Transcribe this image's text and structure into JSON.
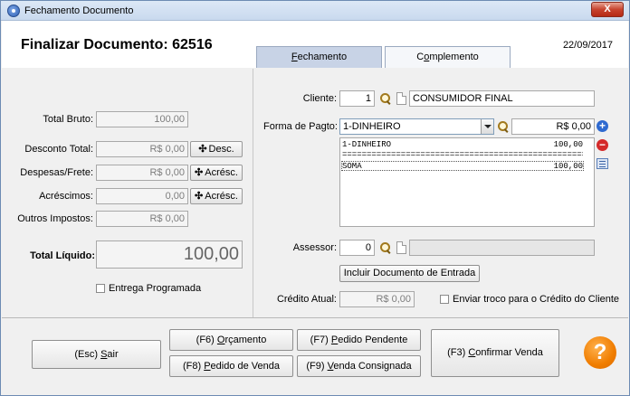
{
  "window": {
    "title": "Fechamento Documento",
    "close_label": "X"
  },
  "header": {
    "title": "Finalizar Documento: 62516",
    "date": "22/09/2017"
  },
  "tabs": [
    {
      "label_pre": "",
      "label_u": "F",
      "label_post": "echamento",
      "active": true
    },
    {
      "label_pre": "C",
      "label_u": "o",
      "label_post": "mplemento",
      "active": false
    }
  ],
  "totals": {
    "total_bruto_label": "Total Bruto:",
    "total_bruto_value": "100,00",
    "desconto_label": "Desconto Total:",
    "desconto_value": "R$ 0,00",
    "desconto_button": "Desc.",
    "despesas_label": "Despesas/Frete:",
    "despesas_value": "R$ 0,00",
    "despesas_button": "Acrésc.",
    "acrescimos_label": "Acréscimos:",
    "acrescimos_value": "0,00",
    "acrescimos_button": "Acrésc.",
    "outros_label": "Outros Impostos:",
    "outros_value": "R$ 0,00",
    "liquido_label": "Total Líquido:",
    "liquido_value": "100,00",
    "entrega_label": "Entrega Programada"
  },
  "cliente": {
    "label": "Cliente:",
    "code": "1",
    "name": "CONSUMIDOR FINAL"
  },
  "pagamento": {
    "label": "Forma de Pagto:",
    "selected": "1-DINHEIRO",
    "amount": "R$ 0,00",
    "rows": [
      {
        "name": "1-DINHEIRO",
        "value": "100,00"
      },
      {
        "name": "=======================================================",
        "value": ""
      },
      {
        "name": "SOMA",
        "value": "100,00"
      }
    ]
  },
  "assessor": {
    "label": "Assessor:",
    "code": "0",
    "name": ""
  },
  "incluir_button": "Incluir Documento de Entrada",
  "credito": {
    "label": "Crédito Atual:",
    "value": "R$ 0,00",
    "troco_label": "Enviar troco para o Crédito do Cliente"
  },
  "footer": {
    "sair": {
      "pre": "(Esc) ",
      "u": "S",
      "post": "air"
    },
    "orcamento": {
      "pre": "(F6) ",
      "u": "O",
      "post": "rçamento"
    },
    "pedido_pendente": {
      "pre": "(F7) ",
      "u": "P",
      "post": "edido Pendente"
    },
    "pedido_venda": {
      "pre": "(F8) ",
      "u": "P",
      "post": "edido de Venda"
    },
    "venda_consignada": {
      "pre": "(F9) ",
      "u": "V",
      "post": "enda Consignada"
    },
    "confirmar": {
      "pre": "(F3) ",
      "u": "C",
      "post": "onfirmar Venda"
    },
    "help": "?"
  }
}
